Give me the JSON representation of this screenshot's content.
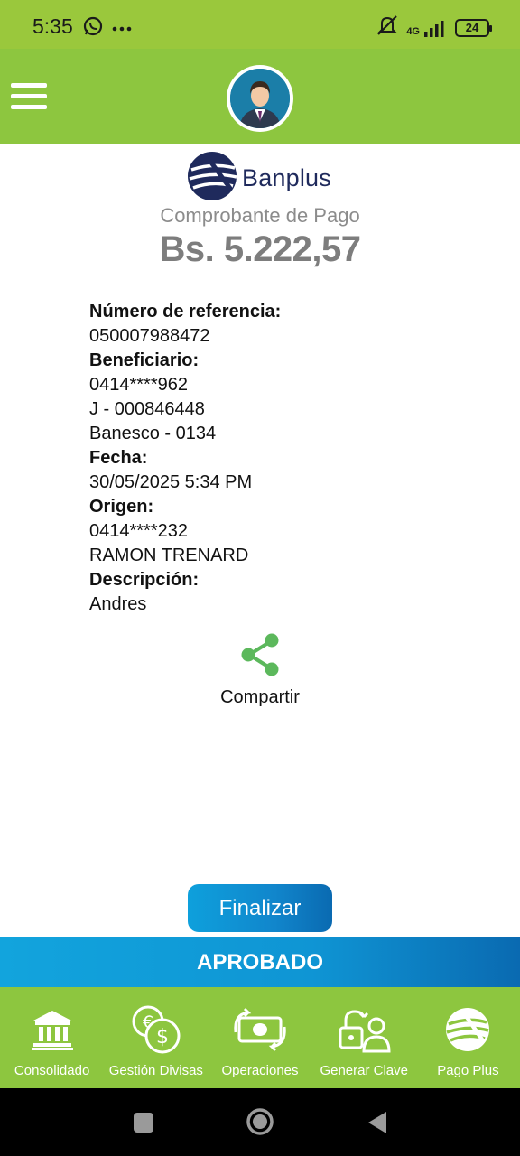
{
  "status_bar": {
    "time": "5:35",
    "network": "4G",
    "battery": "24",
    "icons": [
      "whatsapp-icon",
      "more-dots-icon",
      "mute-icon",
      "signal-icon",
      "battery-icon"
    ]
  },
  "header": {
    "icons": [
      "menu-icon",
      "avatar-icon"
    ]
  },
  "receipt": {
    "bank_name": "Banplus",
    "title": "Comprobante de Pago",
    "amount": "Bs. 5.222,57",
    "reference_label": "Número de referencia:",
    "reference_value": "050007988472",
    "beneficiary_label": "Beneficiario:",
    "beneficiary_phone": "0414****962",
    "beneficiary_id": "J - 000846448",
    "beneficiary_bank": "Banesco - 0134",
    "date_label": "Fecha:",
    "date_value": "30/05/2025 5:34 PM",
    "origin_label": "Origen:",
    "origin_phone": "0414****232",
    "origin_name": "RAMON TRENARD",
    "description_label": "Descripción:",
    "description_value": "Andres"
  },
  "actions": {
    "share_label": "Compartir",
    "finish_label": "Finalizar",
    "status_label": "APROBADO"
  },
  "bottom_nav": {
    "items": [
      {
        "label": "Consolidado",
        "icon": "bank-icon"
      },
      {
        "label": "Gestión Divisas",
        "icon": "currency-exchange-icon"
      },
      {
        "label": "Operaciones",
        "icon": "cash-transfer-icon"
      },
      {
        "label": "Generar Clave",
        "icon": "lock-user-icon"
      },
      {
        "label": "Pago Plus",
        "icon": "banplus-logo-icon"
      }
    ]
  },
  "colors": {
    "status_bar": "#9ac83c",
    "header_green": "#8dc63f",
    "accent_blue": "#0f95d4",
    "share_green": "#5cb85c",
    "brand_navy": "#1f2a5c"
  }
}
